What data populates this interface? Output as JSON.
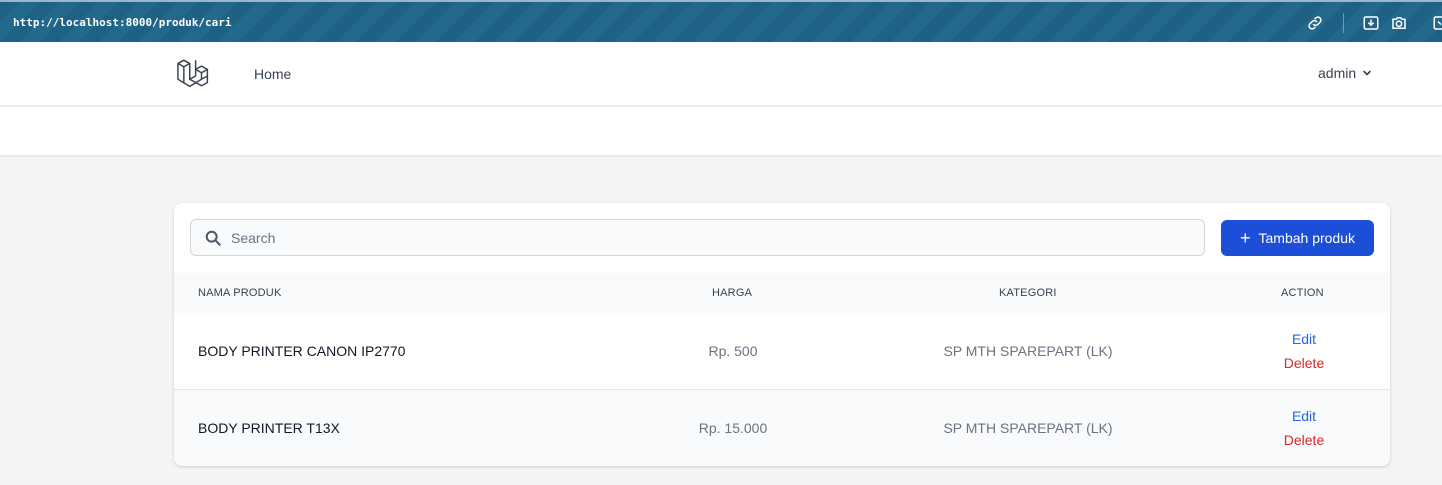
{
  "browser": {
    "url": "http://localhost:8000/produk/cari",
    "icons": [
      "link-icon",
      "download-icon",
      "camera-icon",
      "extension-icon"
    ]
  },
  "nav": {
    "logo_icon": "laravel-logo-icon",
    "home_label": "Home",
    "user_name": "admin"
  },
  "toolbar": {
    "search_placeholder": "Search",
    "search_value": "",
    "add_button_label": "Tambah produk"
  },
  "table": {
    "columns": [
      "NAMA PRODUK",
      "HARGA",
      "KATEGORI",
      "ACTION"
    ],
    "rows": [
      {
        "nama": "BODY PRINTER CANON IP2770",
        "harga": "Rp. 500",
        "kategori": "SP MTH SPAREPART (LK)",
        "edit": "Edit",
        "delete": "Delete"
      },
      {
        "nama": "BODY PRINTER T13X",
        "harga": "Rp. 15.000",
        "kategori": "SP MTH SPAREPART (LK)",
        "edit": "Edit",
        "delete": "Delete"
      }
    ]
  },
  "colors": {
    "primary": "#1d4ed8",
    "edit_link": "#2563eb",
    "delete_link": "#dc2626",
    "browser_bar": "#1e6184"
  }
}
